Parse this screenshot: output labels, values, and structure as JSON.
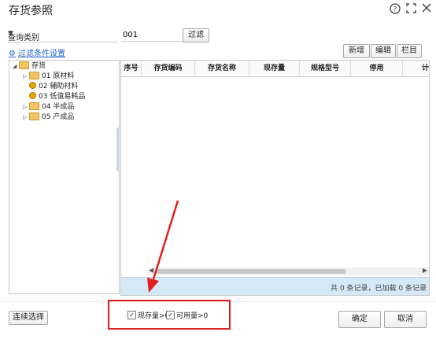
{
  "window": {
    "title": "存货参照",
    "help_icon": "question-circle-icon",
    "maximize_icon": "maximize-icon",
    "close_icon": "close-icon"
  },
  "query": {
    "category_select": "查询类别",
    "input_value": "001",
    "filter_button": "过滤",
    "filter_settings_link": "过滤条件设置"
  },
  "toolbar": {
    "new_label": "新增",
    "edit_label": "编辑",
    "columns_label": "栏目"
  },
  "tree": {
    "root": "存货",
    "items": [
      {
        "label": "01 原材料"
      },
      {
        "label": "02 辅助材料"
      },
      {
        "label": "03 低值易耗品"
      },
      {
        "label": "04 半成品"
      },
      {
        "label": "05 产成品"
      }
    ]
  },
  "grid": {
    "columns": [
      "序号",
      "存货编码",
      "存货名称",
      "现存量",
      "规格型号",
      "停用",
      "计"
    ],
    "footer": "共 0 条记录，已加载 0 条记录"
  },
  "bottom": {
    "continuous_select": "连续选择",
    "stock_qty_label": "现存量>0",
    "available_qty_label": "可用量>0",
    "ok_label": "确定",
    "cancel_label": "取消"
  },
  "annotation": {
    "color": "#e02020"
  }
}
